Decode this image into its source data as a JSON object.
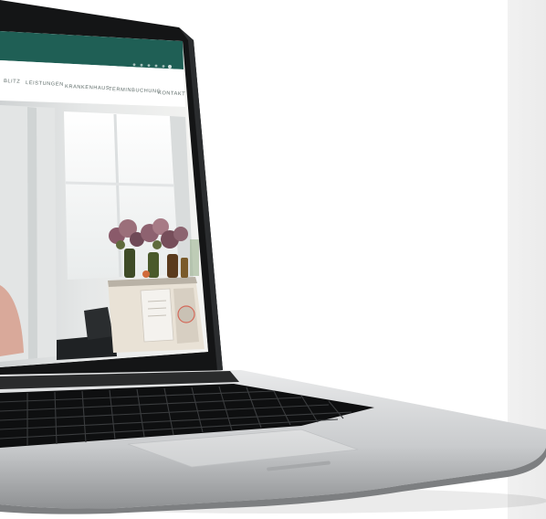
{
  "website": {
    "nav_items": [
      "BLITZ",
      "LEISTUNGEN",
      "KRANKENHAUS",
      "TERMINBUCHUNG",
      "KONTAKT"
    ]
  },
  "colors": {
    "header_bar": "#1f5f55",
    "laptop_body": "#c9cbcd",
    "keyboard": "#1b1c1e"
  }
}
